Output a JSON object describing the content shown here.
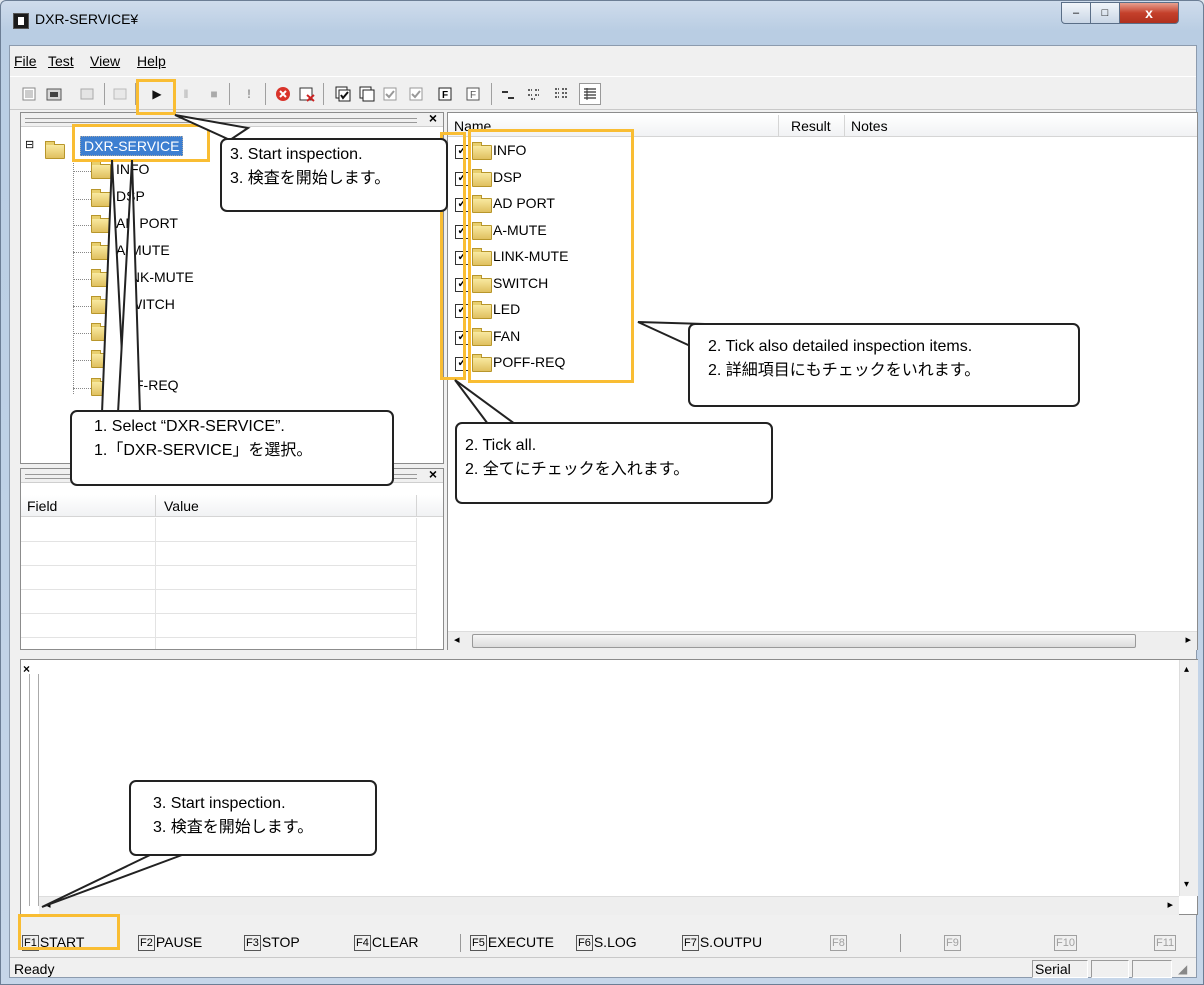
{
  "window": {
    "title": "DXR-SERVICE¥",
    "close_glyph": "x",
    "min_glyph": "–",
    "max_glyph": "□"
  },
  "menu": {
    "items": [
      {
        "label": "File"
      },
      {
        "label": "Test"
      },
      {
        "label": "View"
      },
      {
        "label": "Help"
      }
    ]
  },
  "toolbar": {
    "icons": [
      "new-icon",
      "open-icon",
      "save-icon",
      "settings-icon",
      "start-icon",
      "pause-icon",
      "stop-icon",
      "exclamation-icon",
      "cancel-icon",
      "clear-icon",
      "check-all-icon",
      "check-copy-icon",
      "check-icon",
      "check-disabled-icon",
      "function-f-icon",
      "function-f2-icon",
      "large-icons-view",
      "small-icons-view",
      "list-view",
      "details-view"
    ],
    "start_glyph": "▶",
    "pause_glyph": "ǁ",
    "stop_glyph": "■",
    "exclamation_glyph": "!",
    "cancel_glyph": "✖"
  },
  "tree": {
    "root": "DXR-SERVICE",
    "children": [
      "INFO",
      "DSP",
      "AD PORT",
      "A-MUTE",
      "LINK-MUTE",
      "SWITCH",
      "LED",
      "FAN",
      "POFF-REQ"
    ],
    "visible_labels": [
      "INFO",
      "DSP",
      "AD PORT",
      "A-MUTE",
      "INK-MUTE",
      "WITCH",
      "D",
      "N",
      "F-REQ"
    ],
    "expander": "⊟"
  },
  "properties": {
    "columns": [
      "Field",
      "Value"
    ],
    "close_glyph": "×"
  },
  "list": {
    "columns": [
      "Name",
      "Result",
      "Notes"
    ],
    "items": [
      {
        "name": "INFO",
        "checked": true
      },
      {
        "name": "DSP",
        "checked": true
      },
      {
        "name": "AD PORT",
        "checked": true
      },
      {
        "name": "A-MUTE",
        "checked": true
      },
      {
        "name": "LINK-MUTE",
        "checked": true
      },
      {
        "name": "SWITCH",
        "checked": true
      },
      {
        "name": "LED",
        "checked": true
      },
      {
        "name": "FAN",
        "checked": true
      },
      {
        "name": "POFF-REQ",
        "checked": true
      }
    ],
    "check_glyph": "✓"
  },
  "log": {
    "close_glyph": "×"
  },
  "function_keys": [
    {
      "key": "F1",
      "label": "START",
      "enabled": true
    },
    {
      "key": "F2",
      "label": "PAUSE",
      "enabled": true
    },
    {
      "key": "F3",
      "label": "STOP",
      "enabled": true
    },
    {
      "key": "F4",
      "label": "CLEAR",
      "enabled": true
    },
    {
      "key": "F5",
      "label": "EXECUTE",
      "enabled": true
    },
    {
      "key": "F6",
      "label": "S.LOG",
      "enabled": true
    },
    {
      "key": "F7",
      "label": "S.OUTPU",
      "enabled": true
    },
    {
      "key": "F8",
      "label": "",
      "enabled": false
    },
    {
      "key": "F9",
      "label": "",
      "enabled": false
    },
    {
      "key": "F10",
      "label": "",
      "enabled": false
    },
    {
      "key": "F11",
      "label": "",
      "enabled": false
    }
  ],
  "status": {
    "text": "Ready",
    "panel1": "Serial",
    "panel2": "",
    "panel3": ""
  },
  "annotations": {
    "start_top": [
      "3. Start inspection.",
      "3. 検査を開始します。"
    ],
    "select": [
      "1. Select “DXR-SERVICE”.",
      "1.「DXR-SERVICE」を選択。"
    ],
    "tick_all": [
      "2. Tick all.",
      "2. 全てにチェックを入れます。"
    ],
    "tick_detail": [
      "2. Tick also detailed inspection items.",
      "2. 詳細項目にもチェックをいれます。"
    ],
    "start_bottom": [
      "3. Start inspection.",
      "3. 検査を開始します。"
    ],
    "highlight_color": "#f9bd33"
  }
}
